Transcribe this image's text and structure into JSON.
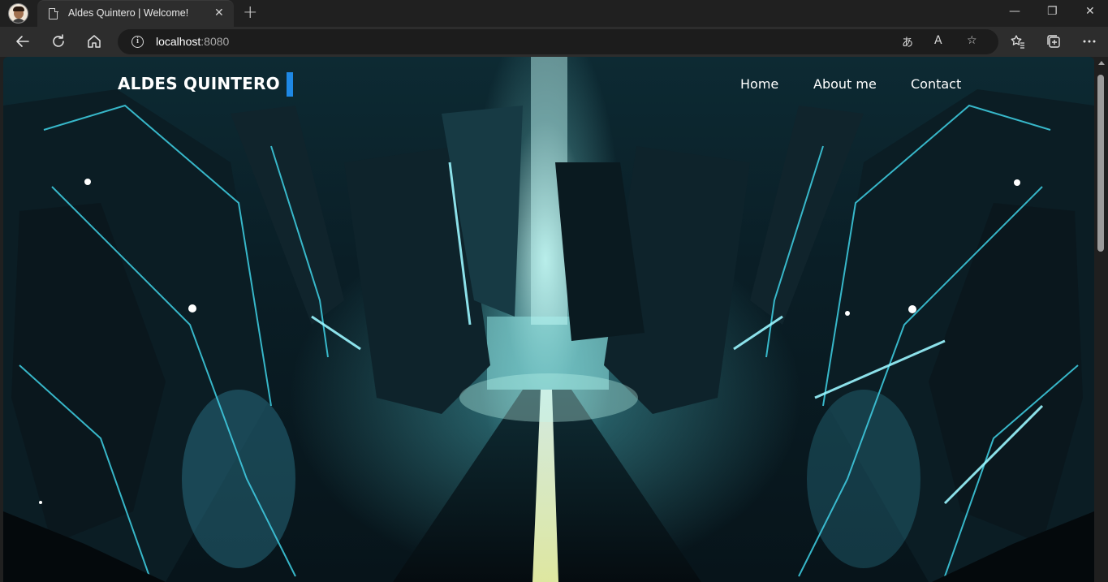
{
  "browser": {
    "tab_title": "Aldes Quintero | Welcome!",
    "tab_close": "✕",
    "new_tab": "+",
    "window_controls": {
      "minimize": "—",
      "restore": "❐",
      "close": "✕"
    },
    "address": {
      "host": "localhost",
      "port": ":8080"
    },
    "toolbar_icons": [
      "back-icon",
      "refresh-icon",
      "home-icon",
      "info-icon",
      "translate-icon",
      "read-aloud-icon",
      "favorite-icon",
      "favorites-icon",
      "collections-icon",
      "more-icon"
    ]
  },
  "site": {
    "logo": "ALDES QUINTERO",
    "accent_color": "#1e88e5",
    "nav": [
      {
        "label": "Home"
      },
      {
        "label": "About me"
      },
      {
        "label": "Contact"
      }
    ],
    "hero_image": "tron-style sci-fi city background"
  }
}
